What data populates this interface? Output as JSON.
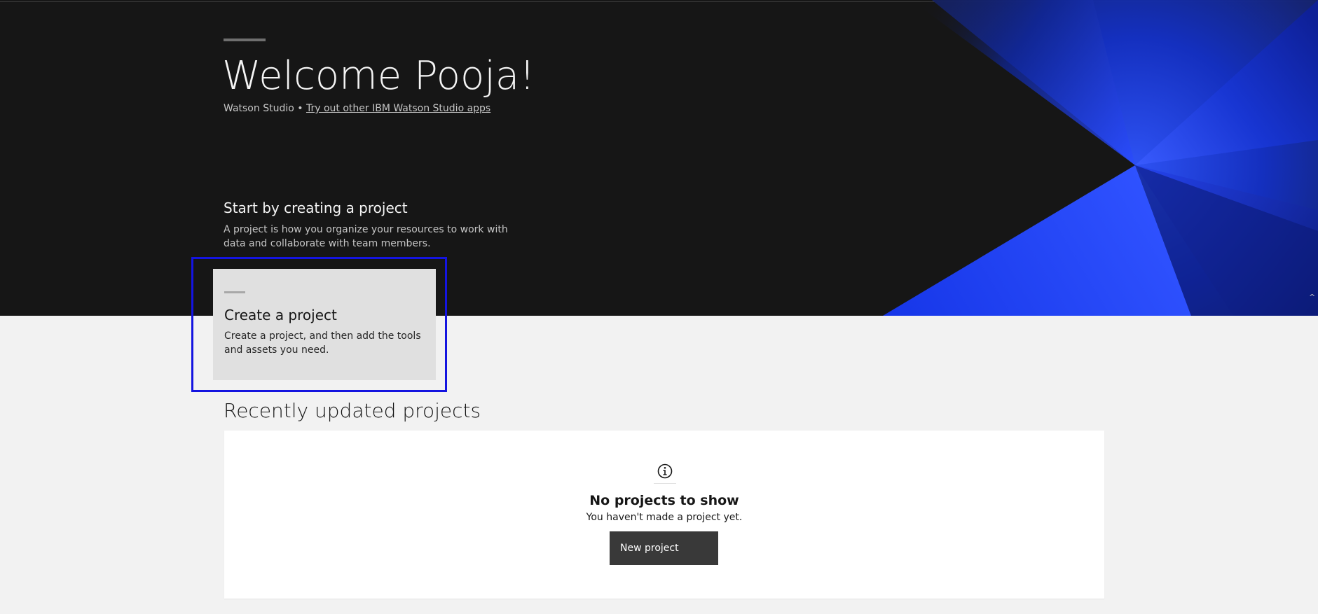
{
  "hero": {
    "welcome": "Welcome Pooja!",
    "product_name": "Watson Studio",
    "separator": "•",
    "apps_link": "Try out other IBM Watson Studio apps",
    "start_title": "Start by creating a project",
    "start_description": "A project is how you organize your resources to work with data and collaborate with team members.",
    "scroll_glyph": "^"
  },
  "create_tile": {
    "title": "Create a project",
    "description": "Create a project, and then add the tools and assets you need."
  },
  "recent": {
    "title": "Recently updated projects",
    "empty_icon": "info-icon",
    "empty_title": "No projects to show",
    "empty_subtitle": "You haven't made a project yet.",
    "new_project_label": "New project"
  },
  "colors": {
    "hero_bg": "#161616",
    "page_bg": "#f2f2f2",
    "accent_blue": "#0f2fe0",
    "highlight_border": "#1414e0",
    "tile_bg": "#e0e0e0",
    "button_bg": "#393939"
  }
}
